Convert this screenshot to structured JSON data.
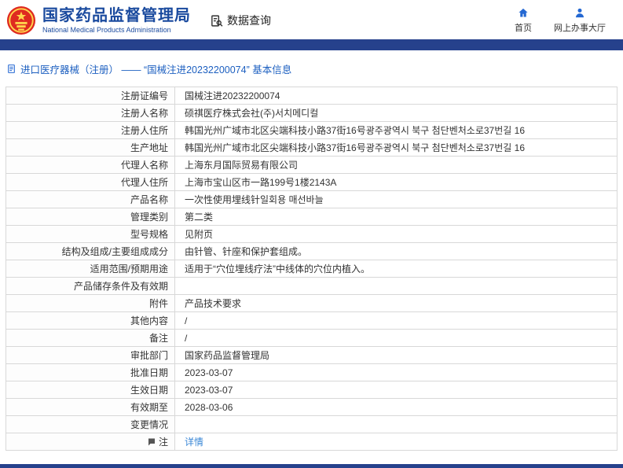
{
  "header": {
    "title": "国家药品监督管理局",
    "subtitle": "National Medical Products Administration",
    "nav_query": "数据查询",
    "home": "首页",
    "hall": "网上办事大厅"
  },
  "breadcrumb": {
    "text": "进口医疗器械（注册） —— “国械注进20232200074” 基本信息"
  },
  "colors": {
    "accent_blue": "#1a4a9e",
    "navbar_blue": "#26418c",
    "link_blue": "#3a87d6",
    "emblem_red": "#df2a20",
    "emblem_gold": "#ffd64d"
  },
  "icons": {
    "emblem": "national-emblem-icon",
    "query": "document-search-icon",
    "home": "home-icon",
    "hall": "user-icon",
    "breadcrumb": "document-icon",
    "note": "note-bubble-icon"
  },
  "table": {
    "rows": [
      {
        "label": "注册证编号",
        "value": "国械注进20232200074"
      },
      {
        "label": "注册人名称",
        "value": "硕祺医疗株式会社(주)서치메디컬"
      },
      {
        "label": "注册人住所",
        "value": "韩国光州广域市北区尖端科技小路37街16号광주광역시 북구 첨단벤처소로37번길 16"
      },
      {
        "label": "生产地址",
        "value": "韩国光州广域市北区尖端科技小路37街16号광주광역시 북구 첨단벤처소로37번길 16"
      },
      {
        "label": "代理人名称",
        "value": "上海东月国际贸易有限公司"
      },
      {
        "label": "代理人住所",
        "value": "上海市宝山区市一路199号1楼2143A"
      },
      {
        "label": "产品名称",
        "value": "一次性使用埋线针일회용 매선바늘"
      },
      {
        "label": "管理类别",
        "value": "第二类"
      },
      {
        "label": "型号规格",
        "value": "见附页"
      },
      {
        "label": "结构及组成/主要组成成分",
        "value": "由针管、针座和保护套组成。"
      },
      {
        "label": "适用范围/预期用途",
        "value": "适用于“穴位埋线疗法”中线体的穴位内植入。"
      },
      {
        "label": "产品储存条件及有效期",
        "value": ""
      },
      {
        "label": "附件",
        "value": "产品技术要求"
      },
      {
        "label": "其他内容",
        "value": "/"
      },
      {
        "label": "备注",
        "value": "/"
      },
      {
        "label": "审批部门",
        "value": "国家药品监督管理局"
      },
      {
        "label": "批准日期",
        "value": "2023-03-07"
      },
      {
        "label": "生效日期",
        "value": "2023-03-07"
      },
      {
        "label": "有效期至",
        "value": "2028-03-06"
      },
      {
        "label": "变更情况",
        "value": ""
      },
      {
        "label": "注",
        "value": "详情"
      }
    ]
  }
}
